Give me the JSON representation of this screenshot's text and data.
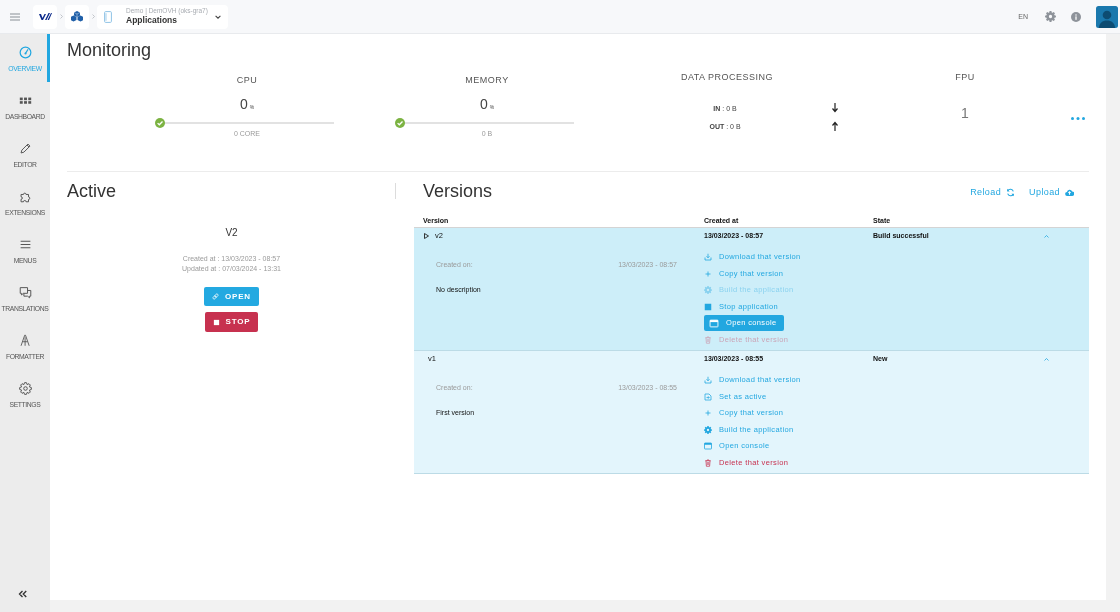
{
  "topbar": {
    "workspace": "Demo | DemOVH (oks-gra7)",
    "page": "Applications",
    "language": "EN"
  },
  "sidebar": {
    "items": [
      {
        "kind": "overview",
        "label": "OVERVIEW",
        "selected": true
      },
      {
        "kind": "dashboard",
        "label": "DASHBOARD",
        "selected": false
      },
      {
        "kind": "editor",
        "label": "EDITOR",
        "selected": false
      },
      {
        "kind": "extensions",
        "label": "EXTENSIONS",
        "selected": false
      },
      {
        "kind": "menus",
        "label": "MENUS",
        "selected": false
      },
      {
        "kind": "translations",
        "label": "TRANSLATIONS",
        "selected": false
      },
      {
        "kind": "formatter",
        "label": "FORMATTER",
        "selected": false
      },
      {
        "kind": "settings",
        "label": "SETTINGS",
        "selected": false
      }
    ]
  },
  "monitoring": {
    "title": "Monitoring",
    "gauges": [
      {
        "label": "CPU",
        "value": "0",
        "unit": "%",
        "level": 0,
        "detail": "0 CORE"
      },
      {
        "label": "MEMORY",
        "value": "0",
        "unit": "%",
        "level": 0,
        "detail": "0 B"
      }
    ],
    "data_processing": {
      "label": "DATA PROCESSING",
      "flows": [
        {
          "kind": "in",
          "text": "**IN** : 0 B"
        },
        {
          "kind": "out",
          "text": "**OUT** : 0 B"
        }
      ]
    },
    "fpu": {
      "label": "FPU",
      "value": "1"
    }
  },
  "active": {
    "title": "Active",
    "version": "V2",
    "created": "Created at : 13/03/2023 - 08:57",
    "updated": "Updated at : 07/03/2024 - 13:31",
    "buttons": [
      {
        "kind": "open",
        "label": "OPEN"
      },
      {
        "kind": "stop",
        "label": "STOP"
      }
    ]
  },
  "versions": {
    "title": "Versions",
    "toolbar": [
      {
        "kind": "reload",
        "label": "Reload"
      },
      {
        "kind": "upload",
        "label": "Upload"
      }
    ],
    "columns": [
      "Version",
      "Created at",
      "State"
    ],
    "rows": [
      {
        "version": "v2",
        "active": true,
        "selected": true,
        "expanded": true,
        "created_at": "13/03/2023 - 08:57",
        "state": "Build successful",
        "details": {
          "created_label": "Created on:",
          "created_value": "13/03/2023 - 08:57",
          "description": "No description"
        },
        "actions": [
          {
            "kind": "download",
            "label": "Download that version",
            "disabled": false,
            "highlighted": false
          },
          {
            "kind": "copy",
            "label": "Copy that version",
            "disabled": false,
            "highlighted": false
          },
          {
            "kind": "build",
            "label": "Build the application",
            "disabled": true,
            "highlighted": false
          },
          {
            "kind": "stop",
            "label": "Stop application",
            "disabled": false,
            "highlighted": false
          },
          {
            "kind": "console",
            "label": "Open console",
            "disabled": false,
            "highlighted": true
          },
          {
            "kind": "delete",
            "label": "Delete that version",
            "disabled": true,
            "highlighted": false
          }
        ]
      },
      {
        "version": "v1",
        "active": false,
        "selected": false,
        "expanded": true,
        "created_at": "13/03/2023 - 08:55",
        "state": "New",
        "details": {
          "created_label": "Created on:",
          "created_value": "13/03/2023 - 08:55",
          "description": "First version"
        },
        "actions": [
          {
            "kind": "download",
            "label": "Download that version",
            "disabled": false,
            "highlighted": false
          },
          {
            "kind": "set_active",
            "label": "Set as active",
            "disabled": false,
            "highlighted": false
          },
          {
            "kind": "copy",
            "label": "Copy that version",
            "disabled": false,
            "highlighted": false
          },
          {
            "kind": "build",
            "label": "Build the application",
            "disabled": false,
            "highlighted": false
          },
          {
            "kind": "console",
            "label": "Open console",
            "disabled": false,
            "highlighted": false
          },
          {
            "kind": "delete",
            "label": "Delete that version",
            "disabled": false,
            "highlighted": false
          }
        ]
      }
    ]
  }
}
